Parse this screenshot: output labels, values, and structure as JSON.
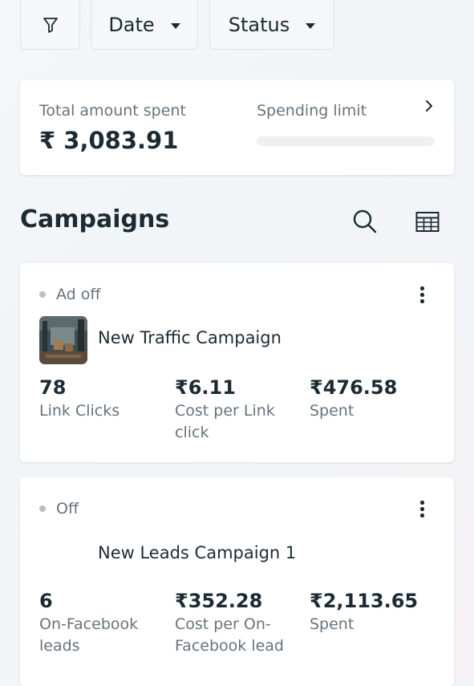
{
  "filters": {
    "date_label": "Date",
    "status_label": "Status"
  },
  "summary": {
    "total_label": "Total amount spent",
    "total_value": "₹ 3,083.91",
    "limit_label": "Spending limit"
  },
  "section": {
    "title": "Campaigns"
  },
  "campaigns": [
    {
      "status": "Ad off",
      "name": "New Traffic Campaign",
      "stats": [
        {
          "value": "78",
          "label": "Link Clicks"
        },
        {
          "value": "₹6.11",
          "label": "Cost per Link click"
        },
        {
          "value": "₹476.58",
          "label": "Spent"
        }
      ]
    },
    {
      "status": "Off",
      "name": "New Leads Campaign 1",
      "stats": [
        {
          "value": "6",
          "label": "On-Facebook leads"
        },
        {
          "value": "₹352.28",
          "label": "Cost per On-Facebook lead"
        },
        {
          "value": "₹2,113.65",
          "label": "Spent"
        }
      ]
    }
  ],
  "icons": {
    "filter": "filter-icon",
    "search": "search-icon",
    "table": "table-icon",
    "more": "more-vertical-icon",
    "chevron": "chevron-right-icon"
  },
  "colors": {
    "text": "#1c2b33",
    "muted": "#66737d",
    "status_dot": "#b9c0c6",
    "card": "#ffffff"
  }
}
